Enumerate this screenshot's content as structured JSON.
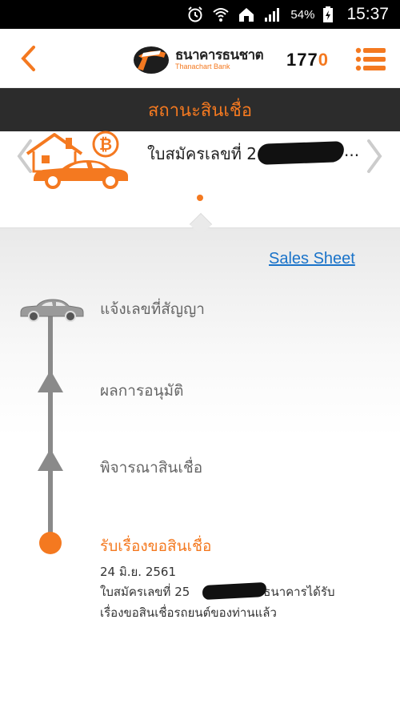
{
  "status_bar": {
    "battery": "54%",
    "time": "15:37"
  },
  "header": {
    "logo_th": "ธนาคารธนชาต",
    "logo_en": "Thanachart Bank",
    "call_center": {
      "prefix": "17",
      "suffix": "7",
      "accent": "0"
    }
  },
  "page": {
    "title": "สถานะสินเชื่อ"
  },
  "carousel": {
    "application_label": "ใบสมัครเลขที่ 2",
    "ellipsis": "..."
  },
  "sales_sheet": "Sales Sheet",
  "timeline": {
    "steps": [
      {
        "label": "แจ้งเลขที่สัญญา"
      },
      {
        "label": "ผลการอนุมัติ"
      },
      {
        "label": "พิจารณาสินเชื่อ"
      },
      {
        "label": "รับเรื่องขอสินเชื่อ",
        "date": "24 มิ.ย. 2561",
        "desc_line1_a": "ใบสมัครเลขที่ 25",
        "desc_line1_b": "ธนาคารได้รับ",
        "desc_line2": "เรื่องขอสินเชื่อรถยนต์ของท่านแล้ว"
      }
    ]
  },
  "colors": {
    "accent": "#f47920",
    "link": "#1a73c9",
    "title_bar": "#2c2c2c",
    "timeline": "#8a8a8a"
  }
}
